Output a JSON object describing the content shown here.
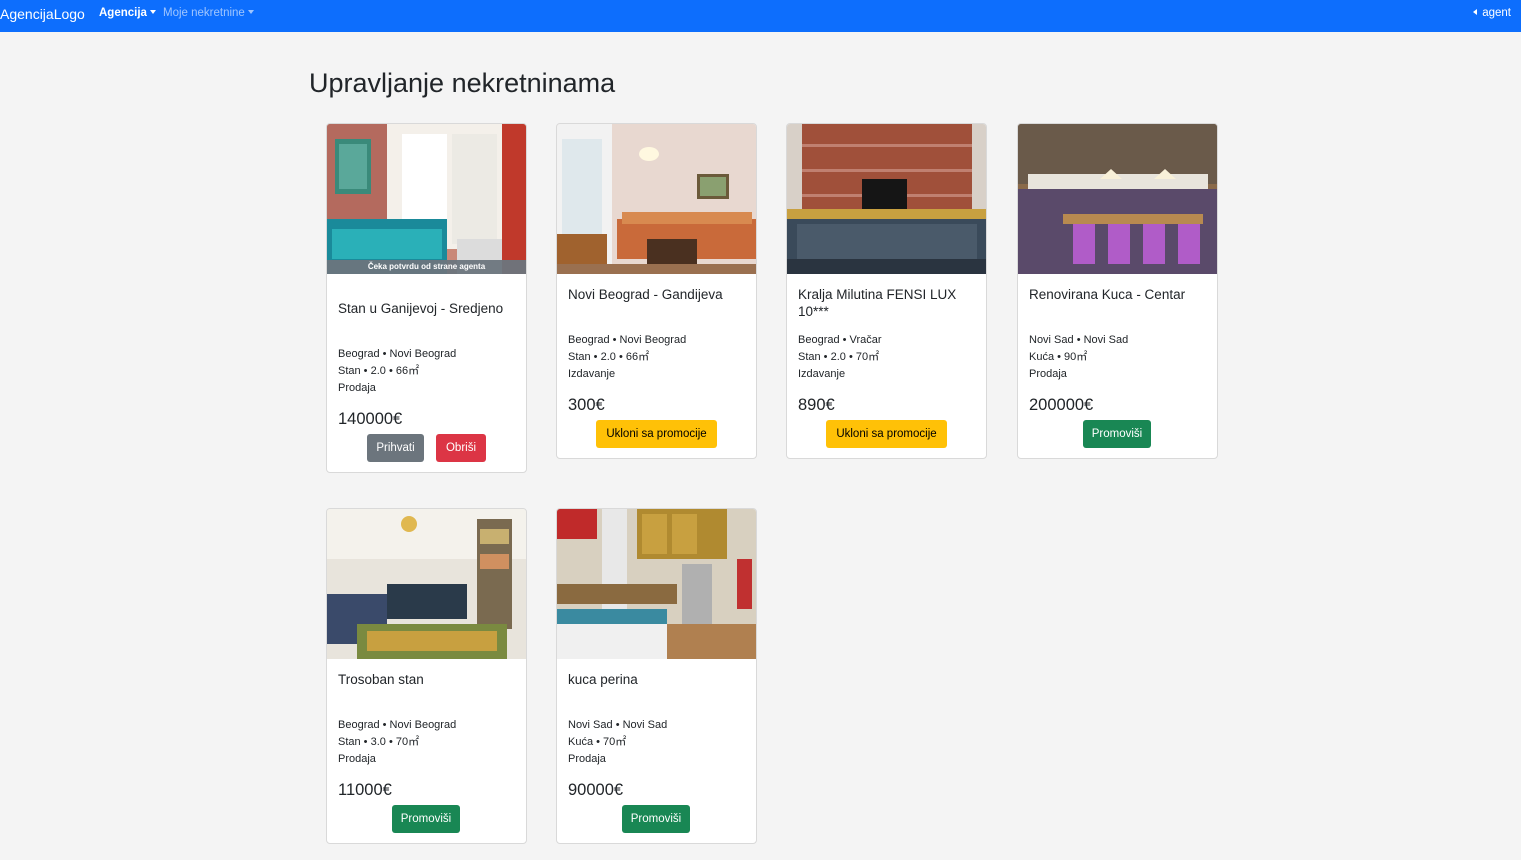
{
  "navbar": {
    "brand": "AgencijaLogo",
    "menu_agencija": "Agencija",
    "menu_moje": "Moje nekretnine",
    "user": "agent"
  },
  "page": {
    "title": "Upravljanje nekretninama"
  },
  "cards": [
    {
      "badge": "Čeka potvrdu od strane agenta",
      "title": "Stan u Ganijevoj - Sredjeno",
      "location": "Beograd • Novi Beograd",
      "details": "Stan • 2.0 • 66㎡",
      "type": "Prodaja",
      "price": "140000€",
      "btn1": "Prihvati",
      "btn2": "Obriši"
    },
    {
      "title": "Novi Beograd - Gandijeva",
      "location": "Beograd • Novi Beograd",
      "details": "Stan • 2.0 • 66㎡",
      "type": "Izdavanje",
      "price": "300€",
      "btn1": "Ukloni sa promocije"
    },
    {
      "title": "Kralja Milutina FENSI LUX 10***",
      "location": "Beograd • Vračar",
      "details": "Stan • 2.0 • 70㎡",
      "type": "Izdavanje",
      "price": "890€",
      "btn1": "Ukloni sa promocije"
    },
    {
      "title": "Renovirana Kuca - Centar",
      "location": "Novi Sad • Novi Sad",
      "details": "Kuća • 90㎡",
      "type": "Prodaja",
      "price": "200000€",
      "btn1": "Promoviši"
    },
    {
      "title": "Trosoban stan",
      "location": "Beograd • Novi Beograd",
      "details": "Stan • 3.0 • 70㎡",
      "type": "Prodaja",
      "price": "11000€",
      "btn1": "Promoviši"
    },
    {
      "title": "kuca perina",
      "location": "Novi Sad • Novi Sad",
      "details": "Kuća • 70㎡",
      "type": "Prodaja",
      "price": "90000€",
      "btn1": "Promoviši"
    }
  ],
  "colors": {
    "navbar": "#0d6efd",
    "secondary": "#6c757d",
    "danger": "#dc3545",
    "warning": "#ffc107",
    "success": "#198754"
  }
}
